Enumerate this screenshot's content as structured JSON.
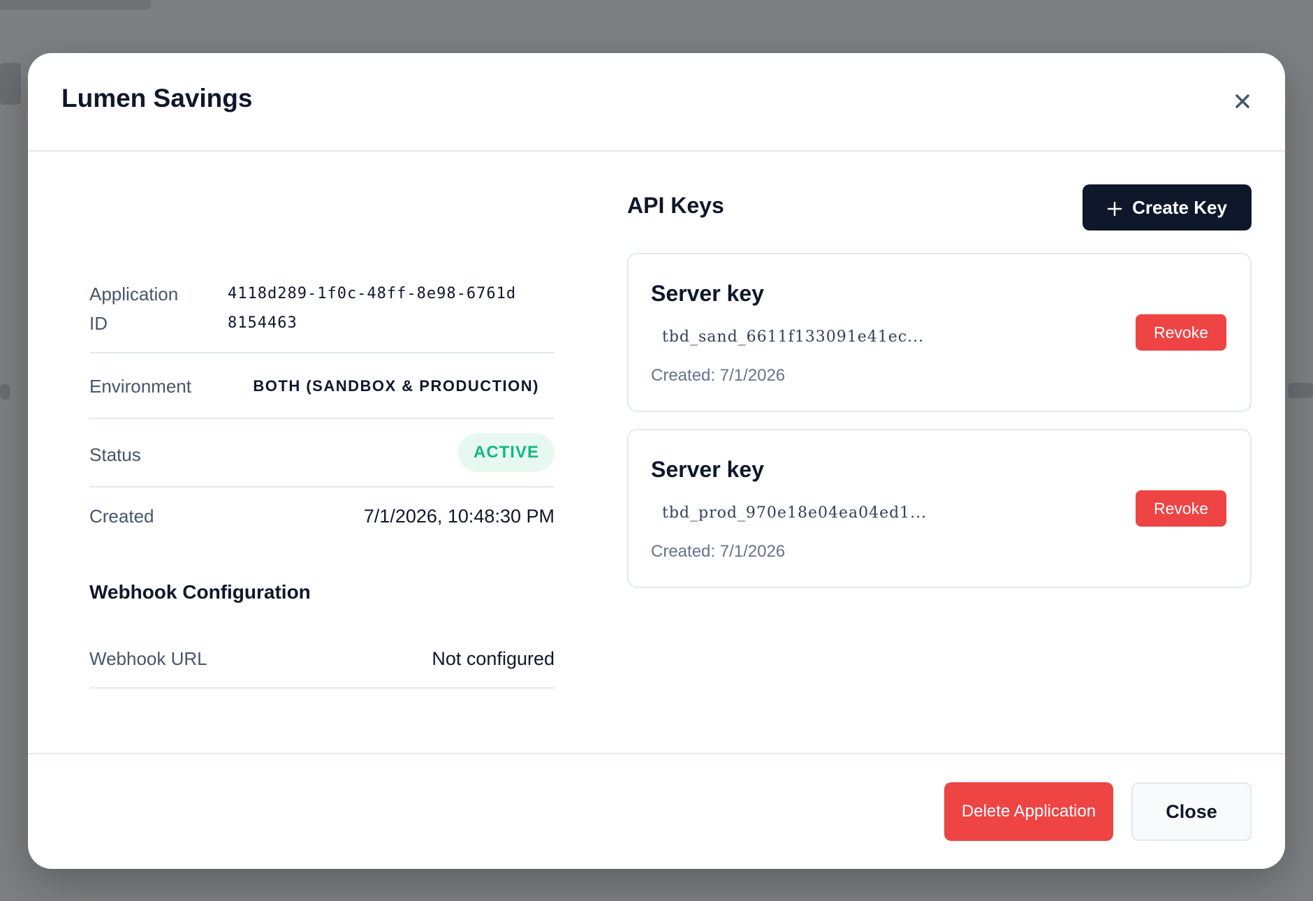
{
  "modal": {
    "title": "Lumen Savings",
    "close_icon": "close-icon"
  },
  "details": {
    "application_id_label": "Application ID",
    "application_id_value": "4118d289-1f0c-48ff-8e98-6761d8154463",
    "environment_label": "Environment",
    "environment_value": "BOTH (SANDBOX & PRODUCTION)",
    "status_label": "Status",
    "status_value": "ACTIVE",
    "created_label": "Created",
    "created_value": "7/1/2026, 10:48:30 PM"
  },
  "webhook": {
    "section_title": "Webhook Configuration",
    "url_label": "Webhook URL",
    "url_value": "Not configured"
  },
  "api_keys": {
    "title": "API Keys",
    "create_label": "Create Key",
    "create_icon": "plus-icon",
    "revoke_label": "Revoke",
    "items": [
      {
        "name": "Server key",
        "value": "tbd_sand_6611f133091e41ec...",
        "created": "Created: 7/1/2026"
      },
      {
        "name": "Server key",
        "value": "tbd_prod_970e18e04ea04ed1...",
        "created": "Created: 7/1/2026"
      }
    ]
  },
  "footer": {
    "delete_label": "Delete Application",
    "close_label": "Close"
  },
  "colors": {
    "primary_dark": "#0f172a",
    "danger": "#ef4444",
    "success": "#10b981",
    "success_bg": "#e7f8f1",
    "border": "#e3e8ef",
    "backdrop": "#7d7f82"
  }
}
